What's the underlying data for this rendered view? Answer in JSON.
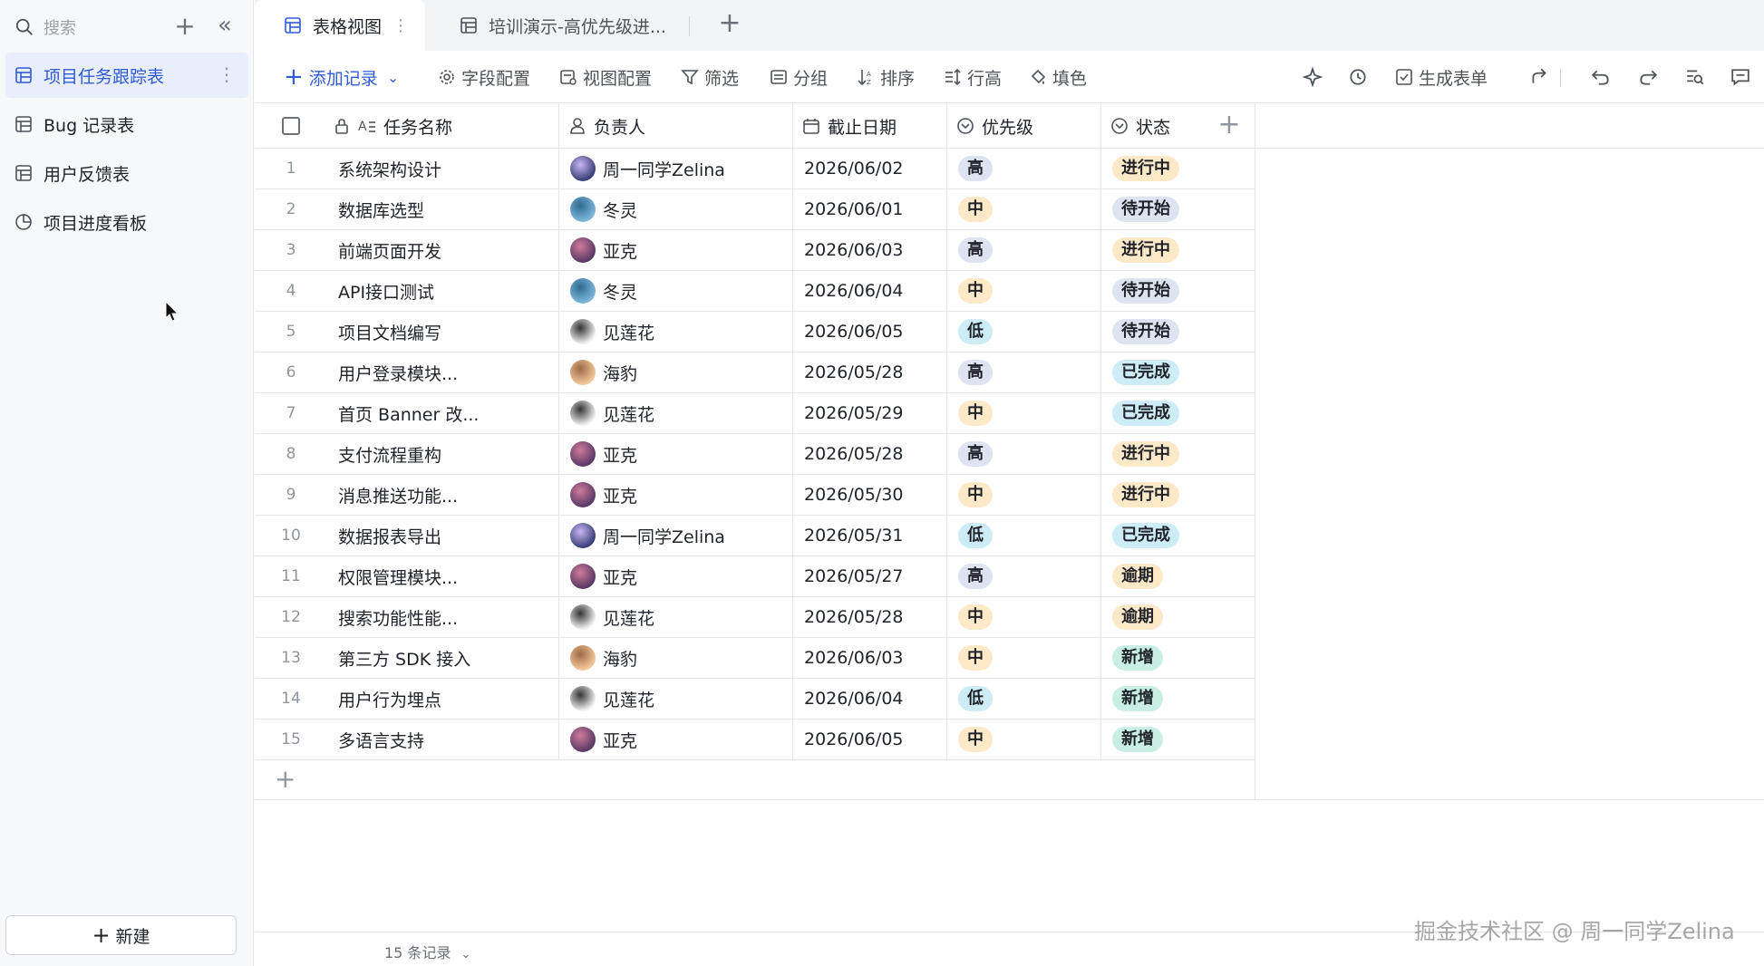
{
  "sidebar": {
    "search_placeholder": "搜索",
    "items": [
      {
        "label": "项目任务跟踪表",
        "icon": "table-icon",
        "active": true
      },
      {
        "label": "Bug 记录表",
        "icon": "table-icon",
        "active": false
      },
      {
        "label": "用户反馈表",
        "icon": "table-icon",
        "active": false
      },
      {
        "label": "项目进度看板",
        "icon": "dashboard-icon",
        "active": false
      }
    ],
    "new_label": "新建"
  },
  "tabs": [
    {
      "label": "表格视图",
      "active": true
    },
    {
      "label": "培训演示-高优先级进...",
      "active": false
    }
  ],
  "toolbar": {
    "add_record": "添加记录",
    "field_config": "字段配置",
    "view_config": "视图配置",
    "filter": "筛选",
    "group": "分组",
    "sort": "排序",
    "row_height": "行高",
    "fill_color": "填色",
    "generate_form": "生成表单"
  },
  "columns": {
    "task": "任务名称",
    "owner": "负责人",
    "due": "截止日期",
    "priority": "优先级",
    "status": "状态"
  },
  "colors": {
    "accent": "#2f5bd8",
    "priority_high": "#dde3f1",
    "priority_mid": "#fde8c8",
    "priority_low": "#cdecf6",
    "status_in_progress": "#fde8c8",
    "status_todo": "#dde3f1",
    "status_done": "#cdecf6",
    "status_overdue": "#fde8c8",
    "status_new": "#c9efe4"
  },
  "rows": [
    {
      "n": "1",
      "task": "系统架构设计",
      "owner": "周一同学Zelina",
      "avatar": "zelina",
      "due": "2026/06/02",
      "priority": "高",
      "status": "进行中"
    },
    {
      "n": "2",
      "task": "数据库选型",
      "owner": "冬灵",
      "avatar": "dongling",
      "due": "2026/06/01",
      "priority": "中",
      "status": "待开始"
    },
    {
      "n": "3",
      "task": "前端页面开发",
      "owner": "亚克",
      "avatar": "yake",
      "due": "2026/06/03",
      "priority": "高",
      "status": "进行中"
    },
    {
      "n": "4",
      "task": "API接口测试",
      "owner": "冬灵",
      "avatar": "dongling",
      "due": "2026/06/04",
      "priority": "中",
      "status": "待开始"
    },
    {
      "n": "5",
      "task": "项目文档编写",
      "owner": "见莲花",
      "avatar": "jianlianhua",
      "due": "2026/06/05",
      "priority": "低",
      "status": "待开始"
    },
    {
      "n": "6",
      "task": "用户登录模块...",
      "owner": "海豹",
      "avatar": "haibao",
      "due": "2026/05/28",
      "priority": "高",
      "status": "已完成"
    },
    {
      "n": "7",
      "task": "首页 Banner 改...",
      "owner": "见莲花",
      "avatar": "jianlianhua",
      "due": "2026/05/29",
      "priority": "中",
      "status": "已完成"
    },
    {
      "n": "8",
      "task": "支付流程重构",
      "owner": "亚克",
      "avatar": "yake",
      "due": "2026/05/28",
      "priority": "高",
      "status": "进行中"
    },
    {
      "n": "9",
      "task": "消息推送功能...",
      "owner": "亚克",
      "avatar": "yake",
      "due": "2026/05/30",
      "priority": "中",
      "status": "进行中"
    },
    {
      "n": "10",
      "task": "数据报表导出",
      "owner": "周一同学Zelina",
      "avatar": "zelina",
      "due": "2026/05/31",
      "priority": "低",
      "status": "已完成"
    },
    {
      "n": "11",
      "task": "权限管理模块...",
      "owner": "亚克",
      "avatar": "yake",
      "due": "2026/05/27",
      "priority": "高",
      "status": "逾期"
    },
    {
      "n": "12",
      "task": "搜索功能性能...",
      "owner": "见莲花",
      "avatar": "jianlianhua",
      "due": "2026/05/28",
      "priority": "中",
      "status": "逾期"
    },
    {
      "n": "13",
      "task": "第三方 SDK 接入",
      "owner": "海豹",
      "avatar": "haibao",
      "due": "2026/06/03",
      "priority": "中",
      "status": "新增"
    },
    {
      "n": "14",
      "task": "用户行为埋点",
      "owner": "见莲花",
      "avatar": "jianlianhua",
      "due": "2026/06/04",
      "priority": "低",
      "status": "新增"
    },
    {
      "n": "15",
      "task": "多语言支持",
      "owner": "亚克",
      "avatar": "yake",
      "due": "2026/06/05",
      "priority": "中",
      "status": "新增"
    }
  ],
  "footer": {
    "count": "15 条记录"
  },
  "watermark": "掘金技术社区 @ 周一同学Zelina"
}
